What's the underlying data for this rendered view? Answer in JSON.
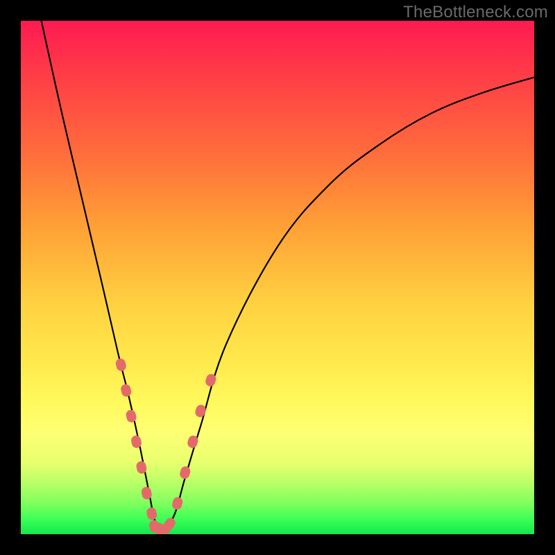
{
  "watermark": "TheBottleneck.com",
  "colors": {
    "frame": "#000000",
    "gradient_top": "#ff1a52",
    "gradient_bottom": "#13e84e",
    "curve": "#000000",
    "beads": "#e46a6a"
  },
  "chart_data": {
    "type": "line",
    "title": "",
    "xlabel": "",
    "ylabel": "",
    "xlim": [
      0,
      100
    ],
    "ylim": [
      0,
      100
    ],
    "grid": false,
    "legend": false,
    "note": "Axes unlabeled; values read by position on 0–100 normalized plot area. Low y = bottom (green), high y = top (red). V-shaped bottleneck curve with minimum near x≈27.",
    "series": [
      {
        "name": "bottleneck-curve",
        "x": [
          4,
          8,
          12,
          16,
          19,
          21,
          23,
          25,
          26,
          27,
          28,
          30,
          32,
          35,
          40,
          50,
          60,
          70,
          80,
          90,
          100
        ],
        "y": [
          100,
          82,
          65,
          48,
          35,
          27,
          18,
          8,
          3,
          1,
          1,
          4,
          11,
          21,
          37,
          56,
          68,
          76,
          82,
          86,
          89
        ]
      }
    ],
    "markers": [
      {
        "name": "left-beads",
        "note": "Pink sausage-shaped markers along the steep left limb of the curve, between roughly y=5 and y=30.",
        "points": [
          {
            "x": 19.5,
            "y": 33
          },
          {
            "x": 20.5,
            "y": 28
          },
          {
            "x": 21.5,
            "y": 23
          },
          {
            "x": 22.5,
            "y": 18
          },
          {
            "x": 23.5,
            "y": 13
          },
          {
            "x": 24.5,
            "y": 8
          },
          {
            "x": 25.5,
            "y": 4
          }
        ]
      },
      {
        "name": "bottom-beads",
        "note": "Pink markers along the very bottom (minimum) of the curve.",
        "points": [
          {
            "x": 26,
            "y": 1.5
          },
          {
            "x": 27,
            "y": 1
          },
          {
            "x": 28,
            "y": 1
          },
          {
            "x": 29,
            "y": 2
          }
        ]
      },
      {
        "name": "right-beads",
        "note": "Pink markers along the lower part of the right limb, between roughly y=5 and y=30.",
        "points": [
          {
            "x": 30.5,
            "y": 6
          },
          {
            "x": 32,
            "y": 12
          },
          {
            "x": 33.5,
            "y": 18
          },
          {
            "x": 35,
            "y": 24
          },
          {
            "x": 37,
            "y": 30
          }
        ]
      }
    ]
  }
}
